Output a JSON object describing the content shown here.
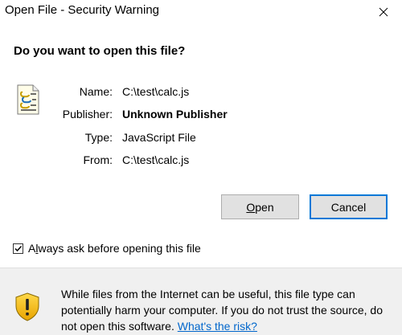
{
  "window": {
    "title": "Open File - Security Warning",
    "close_icon": "close-icon"
  },
  "dialog": {
    "question": "Do you want to open this file?",
    "file_icon": "javascript-file-icon",
    "fields": {
      "name_label": "Name:",
      "name_value": "C:\\test\\calc.js",
      "publisher_label": "Publisher:",
      "publisher_value": "Unknown Publisher",
      "type_label": "Type:",
      "type_value": "JavaScript File",
      "from_label": "From:",
      "from_value": "C:\\test\\calc.js"
    },
    "buttons": {
      "open_mnemonic": "O",
      "open_rest": "pen",
      "cancel": "Cancel"
    },
    "checkbox": {
      "checked": true,
      "label_before": "A",
      "label_mnemonic": "l",
      "label_after": "ways ask before opening this file"
    }
  },
  "footer": {
    "shield_icon": "warning-shield-icon",
    "warning_text": "While files from the Internet can be useful, this file type can potentially harm your computer. If you do not trust the source, do not open this software.",
    "risk_link": "What's the risk?"
  },
  "colors": {
    "accent": "#0078d7",
    "link": "#0066cc",
    "footer_bg": "#f0f0f0",
    "button_bg": "#e1e1e1"
  }
}
